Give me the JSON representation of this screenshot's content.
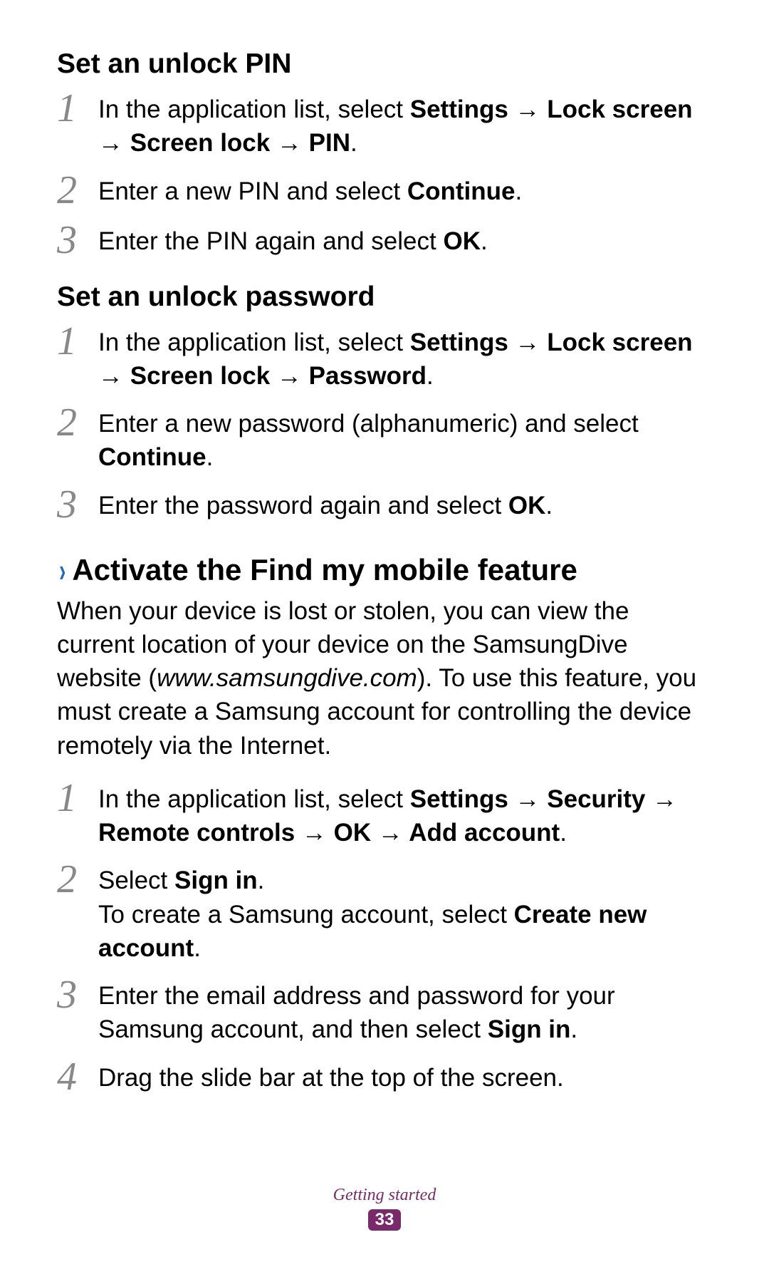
{
  "sections": {
    "pin": {
      "heading": "Set an unlock PIN",
      "steps": {
        "s1": {
          "num": "1",
          "pre": "In the application list, select ",
          "bold": "Settings → Lock screen → Screen lock → PIN",
          "post": "."
        },
        "s2": {
          "num": "2",
          "pre": "Enter a new PIN and select ",
          "bold": "Continue",
          "post": "."
        },
        "s3": {
          "num": "3",
          "pre": "Enter the PIN again and select ",
          "bold": "OK",
          "post": "."
        }
      }
    },
    "password": {
      "heading": "Set an unlock password",
      "steps": {
        "s1": {
          "num": "1",
          "pre": "In the application list, select ",
          "bold": "Settings → Lock screen → Screen lock → Password",
          "post": "."
        },
        "s2": {
          "num": "2",
          "pre": "Enter a new password (alphanumeric) and select ",
          "bold": "Continue",
          "post": "."
        },
        "s3": {
          "num": "3",
          "pre": "Enter the password again and select ",
          "bold": "OK",
          "post": "."
        }
      }
    },
    "findmobile": {
      "title": "Activate the Find my mobile feature",
      "intro": {
        "pre": "When your device is lost or stolen, you can view the current location of your device on the SamsungDive website (",
        "italic": "www.samsungdive.com",
        "post": "). To use this feature, you must create a Samsung account for controlling the device remotely via the Internet."
      },
      "steps": {
        "s1": {
          "num": "1",
          "pre": "In the application list, select ",
          "bold": "Settings → Security → Remote controls → OK → Add account",
          "post": "."
        },
        "s2": {
          "num": "2",
          "line1_pre": "Select ",
          "line1_bold": "Sign in",
          "line1_post": ".",
          "line2_pre": "To create a Samsung account, select ",
          "line2_bold": "Create new account",
          "line2_post": "."
        },
        "s3": {
          "num": "3",
          "pre": "Enter the email address and password for your Samsung account, and then select ",
          "bold": "Sign in",
          "post": "."
        },
        "s4": {
          "num": "4",
          "pre": "Drag the slide bar at the top of the screen.",
          "bold": "",
          "post": ""
        }
      }
    }
  },
  "footer": {
    "section": "Getting started",
    "page": "33"
  }
}
